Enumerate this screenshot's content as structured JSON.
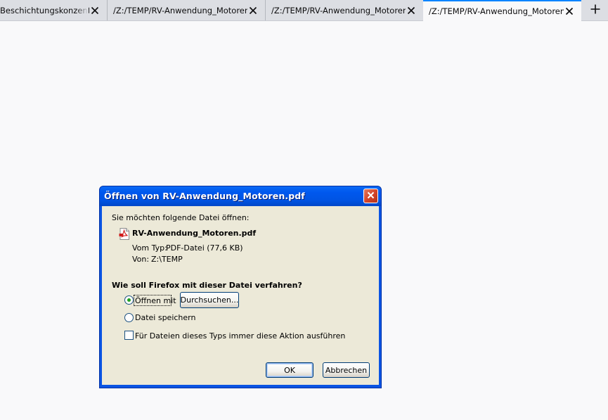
{
  "tabs": [
    {
      "title": "Beschichtungskonzentrat"
    },
    {
      "title": "/Z:/TEMP/RV-Anwendung_Motoren.pdf"
    },
    {
      "title": "/Z:/TEMP/RV-Anwendung_Motoren.pdf"
    },
    {
      "title": "/Z:/TEMP/RV-Anwendung_Motoren.pdf",
      "active": true
    }
  ],
  "icons": {
    "tab_close": "close-icon",
    "new_tab": "plus-icon",
    "dialog_close": "close-icon",
    "file": "pdf-file-icon"
  },
  "colors": {
    "titlebar": "#0054e3",
    "dialog_bg": "#ece9d8",
    "active_tab_accent": "#0a84ff",
    "close_button": "#d5452a"
  },
  "dialog": {
    "title": "Öffnen von RV-Anwendung_Motoren.pdf",
    "intro": "Sie möchten folgende Datei öffnen:",
    "filename": "RV-Anwendung_Motoren.pdf",
    "type_label": "Vom Typ:",
    "type_value": "PDF-Datei (77,6 KB)",
    "from_label": "Von:",
    "from_value": "Z:\\TEMP",
    "question": "Wie soll Firefox mit dieser Datei verfahren?",
    "open_with_label": "Öffnen mit",
    "open_with_selected": true,
    "browse_button": "Durchsuchen...",
    "save_label": "Datei speichern",
    "save_selected": false,
    "always_label": "Für Dateien dieses Typs immer diese Aktion ausführen",
    "always_checked": false,
    "ok_button": "OK",
    "cancel_button": "Abbrechen"
  }
}
